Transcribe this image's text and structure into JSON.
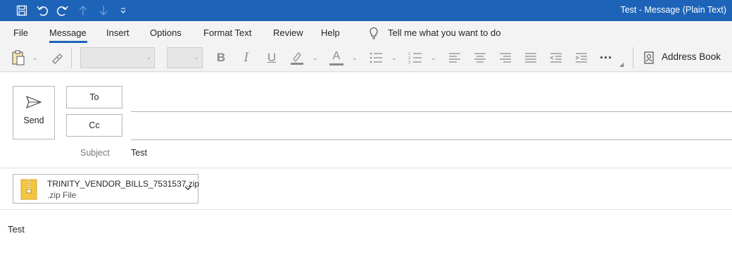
{
  "window": {
    "title": "Test  -  Message (Plain Text)"
  },
  "quick_access": {
    "icons": [
      "save-icon",
      "undo-icon",
      "redo-icon",
      "up-arrow-icon",
      "down-arrow-icon",
      "customize-icon"
    ]
  },
  "menu": {
    "tabs": [
      "File",
      "Message",
      "Insert",
      "Options",
      "Format Text",
      "Review",
      "Help"
    ],
    "active": "Message",
    "tell_me": "Tell me what you want to do"
  },
  "ribbon": {
    "font_name": "",
    "font_size": "",
    "address_book": "Address Book",
    "icons": [
      "paste-icon",
      "format-painter-icon",
      "bold-icon",
      "italic-icon",
      "underline-icon",
      "highlight-icon",
      "font-color-icon",
      "bullets-icon",
      "numbering-icon",
      "align-left-icon",
      "align-center-icon",
      "align-right-icon",
      "justify-icon",
      "decrease-indent-icon",
      "increase-indent-icon",
      "more-icon",
      "address-book-icon"
    ],
    "bold": "B",
    "italic": "I",
    "underline": "U",
    "font_color_letter": "A",
    "more": "···"
  },
  "compose": {
    "send_label": "Send",
    "to_label": "To",
    "cc_label": "Cc",
    "to_value": "",
    "cc_value": "",
    "subject_label": "Subject",
    "subject_value": "Test"
  },
  "attachment": {
    "name": "TRINITY_VENDOR_BILLS_7531537.zip",
    "type": ".zip File"
  },
  "body": {
    "text": "Test"
  },
  "colors": {
    "accent": "#1d64b8",
    "ribbon_bg": "#f3f3f3"
  }
}
